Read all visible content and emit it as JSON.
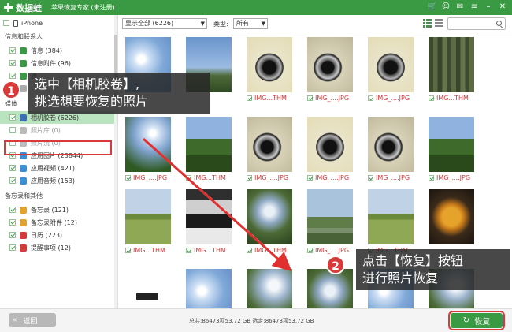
{
  "app": {
    "brand": "数据蛙",
    "title": "苹果恢复专家 (未注册)",
    "accent": "#3a9a43",
    "highlight": "#d83a3a"
  },
  "sidebar": {
    "device": "iPhone",
    "groups": [
      {
        "label": "信息和联系人",
        "items": [
          {
            "label": "信息 (384)",
            "icon_color": "#3a9a43",
            "checked": true
          },
          {
            "label": "信息附件 (96)",
            "icon_color": "#3a9a43",
            "checked": true
          },
          {
            "label": "通",
            "icon_color": "#3a9a43",
            "checked": true
          },
          {
            "label": "",
            "icon_color": "#aaa",
            "checked": false
          }
        ]
      },
      {
        "label": "媒体",
        "items": [
          {
            "label": "相机胶卷 (6226)",
            "icon_color": "#3b6fb6",
            "checked": true,
            "selected": true
          },
          {
            "label": "照片库 (0)",
            "icon_color": "#bbb",
            "checked": false,
            "dim": true
          },
          {
            "label": "照片流 (0)",
            "icon_color": "#bbb",
            "checked": false,
            "dim": true
          },
          {
            "label": "应用图片 (23844)",
            "icon_color": "#3b8fd6",
            "checked": true
          },
          {
            "label": "应用视频 (421)",
            "icon_color": "#3b8fd6",
            "checked": true
          },
          {
            "label": "应用音频 (153)",
            "icon_color": "#3b8fd6",
            "checked": true
          }
        ]
      },
      {
        "label": "备忘录和其他",
        "items": [
          {
            "label": "备忘录 (121)",
            "icon_color": "#e0a42a",
            "checked": true
          },
          {
            "label": "备忘录附件 (12)",
            "icon_color": "#e0a42a",
            "checked": true
          },
          {
            "label": "日历 (223)",
            "icon_color": "#d83a3a",
            "checked": true
          },
          {
            "label": "提醒事项 (12)",
            "icon_color": "#d83a3a",
            "checked": true
          }
        ]
      }
    ]
  },
  "toolbar": {
    "filter_value": "显示全部 (6226)",
    "type_label": "类型:",
    "type_value": "所有"
  },
  "grid": {
    "rows": [
      [
        {
          "thumb": "sky1",
          "name": "",
          "checked": false
        },
        {
          "thumb": "sky2",
          "name": "",
          "checked": false
        },
        {
          "thumb": "lens",
          "name": "IMG...THM",
          "checked": true
        },
        {
          "thumb": "lens2",
          "name": "IMG_....JPG",
          "checked": true
        },
        {
          "thumb": "lens",
          "name": "IMG_....JPG",
          "checked": true
        },
        {
          "thumb": "bamboo",
          "name": "IMG...THM",
          "checked": true
        }
      ],
      [
        {
          "thumb": "sun",
          "name": "IMG_....JPG",
          "checked": true
        },
        {
          "thumb": "trees",
          "name": "IMG...THM",
          "checked": true
        },
        {
          "thumb": "lens2",
          "name": "IMG_....JPG",
          "checked": true
        },
        {
          "thumb": "lens",
          "name": "IMG_....JPG",
          "checked": true
        },
        {
          "thumb": "lens2",
          "name": "IMG_....JPG",
          "checked": true
        },
        {
          "thumb": "trees",
          "name": "IMG_....JPG",
          "checked": true
        }
      ],
      [
        {
          "thumb": "field",
          "name": "IMG...THM",
          "checked": true
        },
        {
          "thumb": "product",
          "name": "IMG...THM",
          "checked": true
        },
        {
          "thumb": "canopy",
          "name": "IMG...THM",
          "checked": true
        },
        {
          "thumb": "city",
          "name": "IMG_....JPG",
          "checked": true
        },
        {
          "thumb": "field",
          "name": "IMG...THM",
          "checked": true
        },
        {
          "thumb": "food",
          "name": "",
          "checked": false
        }
      ],
      [
        {
          "thumb": "device",
          "name": "",
          "checked": false
        },
        {
          "thumb": "sky1",
          "name": "",
          "checked": false
        },
        {
          "thumb": "canopy2",
          "name": "",
          "checked": false
        },
        {
          "thumb": "canopy",
          "name": "",
          "checked": false
        },
        {
          "thumb": "sky1",
          "name": "",
          "checked": false
        },
        {
          "thumb": "canopy2",
          "name": "",
          "checked": false
        }
      ]
    ]
  },
  "status": {
    "back_label": "返回",
    "stats": "总共:86473项53.72 GB 选定:86473项53.72 GB",
    "recover_label": "恢复"
  },
  "callouts": {
    "step1_num": "1",
    "step1_line1": "选中【相机胶卷】,",
    "step1_line2": "挑选想要恢复的照片",
    "step2_num": "2",
    "step2_line1": "点击【恢复】按钮",
    "step2_line2": "进行照片恢复"
  }
}
